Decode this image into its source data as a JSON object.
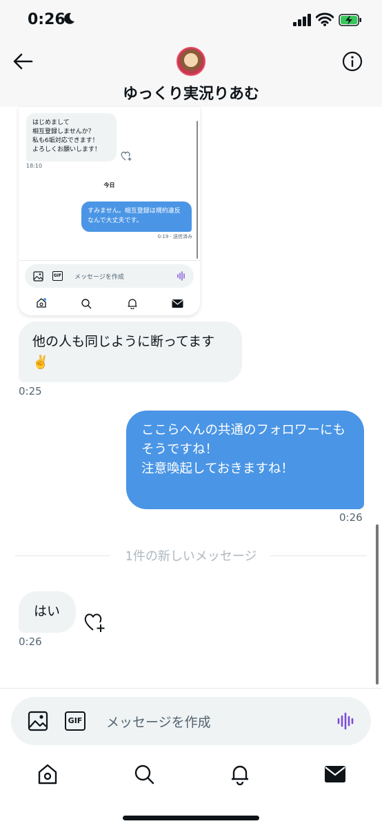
{
  "status_bar": {
    "time": "0:26",
    "icons": [
      "moon-icon",
      "signal-icon",
      "wifi-icon",
      "battery-charging-icon"
    ]
  },
  "header": {
    "title": "ゆっくり実況りあむ",
    "back_icon": "arrow-left-icon",
    "info_icon": "info-icon"
  },
  "embedded_screenshot": {
    "incoming_text": "はじめまして\n相互登録しませんか？\n私も6垢対応できます！\nよろしくお願いします！",
    "incoming_time": "18:10",
    "day_label": "今日",
    "outgoing_text": "すみません。相互登録は規約違反なんで大丈夫です。",
    "outgoing_status": "0:19 · 送信済み",
    "compose_placeholder": "メッセージを作成",
    "gif_label": "GIF"
  },
  "messages": [
    {
      "direction": "incoming",
      "text": "他の人も同じように断ってます\n✌️",
      "time": "0:25"
    },
    {
      "direction": "outgoing",
      "text": "ここらへんの共通のフォロワーにも\nそうですね！\n注意喚起しておきますね！",
      "time": "0:26"
    },
    {
      "direction": "incoming",
      "text": "はい",
      "time": "0:26"
    }
  ],
  "new_messages_divider": "1件の新しいメッセージ",
  "composer": {
    "placeholder": "メッセージを作成",
    "gif_label": "GIF",
    "icons": [
      "image-icon",
      "gif-icon",
      "voice-icon"
    ]
  },
  "tabs": [
    "home-icon",
    "search-icon",
    "notifications-icon",
    "messages-icon"
  ],
  "colors": {
    "accent": "#4a95e5",
    "bubble_incoming": "#eff3f4",
    "voice": "#7c4dd8"
  }
}
